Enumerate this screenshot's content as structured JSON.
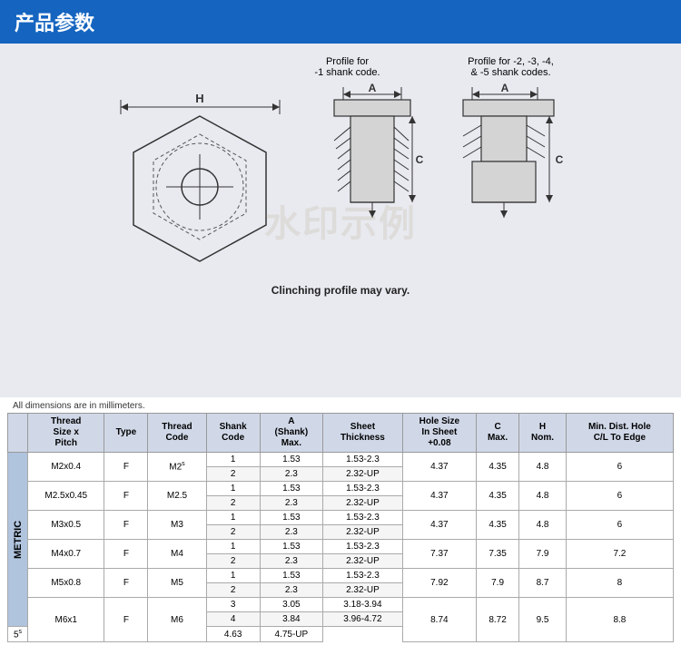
{
  "header": {
    "title": "产品参数"
  },
  "diagram": {
    "profile1_label": "Profile for\n-1 shank code.",
    "profile2_label": "Profile for -2, -3, -4,\n& -5 shank codes.",
    "clinch_note": "Clinching profile may vary.",
    "dimensions_note": "All dimensions are in millimeters."
  },
  "table": {
    "headers": [
      "Thread\nSize x\nPitch",
      "Type",
      "Thread\nCode",
      "Shank\nCode",
      "A\n(Shank)\nMax.",
      "Sheet\nThickness",
      "Hole Size\nIn Sheet\n+0.08",
      "C\nMax.",
      "H\nNom.",
      "Min. Dist. Hole\nC/L To Edge"
    ],
    "metric_label": "METRIC",
    "rows": [
      {
        "thread": "M2x0.4",
        "type": "F",
        "thread_code": "M2ˢ",
        "shank_codes": [
          "1",
          "2"
        ],
        "a_max": [
          "1.53",
          "2.3"
        ],
        "sheet_thickness": [
          "1.53-2.3",
          "2.32-UP"
        ],
        "hole_size": "4.37",
        "c_max": "4.35",
        "h_nom": "4.8",
        "min_dist": "6",
        "rowspan": 2
      },
      {
        "thread": "M2.5x0.45",
        "type": "F",
        "thread_code": "M2.5",
        "shank_codes": [
          "1",
          "2"
        ],
        "a_max": [
          "1.53",
          "2.3"
        ],
        "sheet_thickness": [
          "1.53-2.3",
          "2.32-UP"
        ],
        "hole_size": "4.37",
        "c_max": "4.35",
        "h_nom": "4.8",
        "min_dist": "6",
        "rowspan": 2
      },
      {
        "thread": "M3x0.5",
        "type": "F",
        "thread_code": "M3",
        "shank_codes": [
          "1",
          "2"
        ],
        "a_max": [
          "1.53",
          "2.3"
        ],
        "sheet_thickness": [
          "1.53-2.3",
          "2.32-UP"
        ],
        "hole_size": "4.37",
        "c_max": "4.35",
        "h_nom": "4.8",
        "min_dist": "6",
        "rowspan": 2
      },
      {
        "thread": "M4x0.7",
        "type": "F",
        "thread_code": "M4",
        "shank_codes": [
          "1",
          "2"
        ],
        "a_max": [
          "1.53",
          "2.3"
        ],
        "sheet_thickness": [
          "1.53-2.3",
          "2.32-UP"
        ],
        "hole_size": "7.37",
        "c_max": "7.35",
        "h_nom": "7.9",
        "min_dist": "7.2",
        "rowspan": 2
      },
      {
        "thread": "M5x0.8",
        "type": "F",
        "thread_code": "M5",
        "shank_codes": [
          "1",
          "2"
        ],
        "a_max": [
          "1.53",
          "2.3"
        ],
        "sheet_thickness": [
          "1.53-2.3",
          "2.32-UP"
        ],
        "hole_size": "7.92",
        "c_max": "7.9",
        "h_nom": "8.7",
        "min_dist": "8",
        "rowspan": 2
      },
      {
        "thread": "M6x1",
        "type": "F",
        "thread_code": "M6",
        "shank_codes": [
          "3",
          "4",
          "5ˢ"
        ],
        "a_max": [
          "3.05",
          "3.84",
          "4.63"
        ],
        "sheet_thickness": [
          "3.18-3.94",
          "3.96-4.72",
          "4.75-UP"
        ],
        "hole_size": "8.74",
        "c_max": "8.72",
        "h_nom": "9.5",
        "min_dist": "8.8",
        "rowspan": 3
      }
    ]
  }
}
